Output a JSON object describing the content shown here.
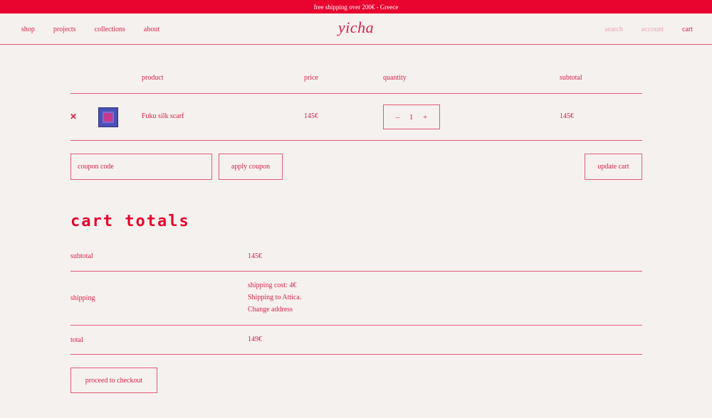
{
  "topbar": {
    "text": "free shipping over 200€ - Greece"
  },
  "header": {
    "logo": "yicha",
    "nav_left": [
      "shop",
      "projects",
      "collections",
      "about"
    ],
    "nav_right": [
      "search",
      "account",
      "cart"
    ]
  },
  "cart_table": {
    "columns": [
      "product",
      "price",
      "quantity",
      "subtotal"
    ],
    "items": [
      {
        "name": "Fuku silk scarf",
        "price": "145€",
        "quantity": "1",
        "subtotal": "145€"
      }
    ],
    "remove_symbol": "✕",
    "minus": "–",
    "plus": "+"
  },
  "coupon": {
    "placeholder": "coupon code",
    "apply_label": "apply coupon",
    "update_label": "update cart"
  },
  "totals": {
    "title": "cart totals",
    "subtotal_label": "subtotal",
    "subtotal_value": "145€",
    "shipping_label": "shipping",
    "shipping_cost": "shipping cost: 4€",
    "shipping_to": "Shipping to Attica.",
    "change_address": "Change address",
    "total_label": "total",
    "total_value": "149€",
    "checkout_label": "proceed to checkout"
  },
  "colors": {
    "accent": "#e8042f",
    "background": "#f5f1ee",
    "muted": "#eea3b4"
  },
  "icons": {
    "thumbnail": "product-image"
  }
}
